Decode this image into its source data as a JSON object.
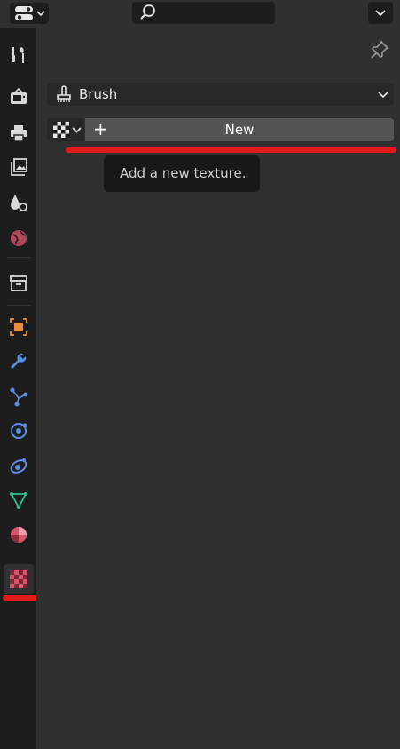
{
  "search": {
    "placeholder": ""
  },
  "context": {
    "label": "Brush"
  },
  "texture": {
    "new_label": "New",
    "new_symbol": "+"
  },
  "tooltip": {
    "text": "Add a new texture."
  },
  "sidebar": {
    "tabs": [
      {
        "name": "tool-tab",
        "icon": "tool-icon"
      },
      {
        "name": "render-tab",
        "icon": "render-icon"
      },
      {
        "name": "output-tab",
        "icon": "output-icon"
      },
      {
        "name": "view-layer-tab",
        "icon": "view-layer-icon"
      },
      {
        "name": "scene-tab",
        "icon": "scene-icon"
      },
      {
        "name": "world-tab",
        "icon": "world-icon"
      },
      {
        "name": "collection-tab",
        "icon": "collection-icon"
      },
      {
        "name": "object-tab",
        "icon": "object-icon"
      },
      {
        "name": "modifiers-tab",
        "icon": "wrench-icon"
      },
      {
        "name": "particles-tab",
        "icon": "particles-icon"
      },
      {
        "name": "physics-tab",
        "icon": "physics-icon"
      },
      {
        "name": "constraints-tab",
        "icon": "constraints-icon"
      },
      {
        "name": "data-tab",
        "icon": "mesh-data-icon"
      },
      {
        "name": "material-tab",
        "icon": "material-icon"
      },
      {
        "name": "texture-tab",
        "icon": "texture-checker-icon",
        "active": true
      }
    ]
  },
  "colors": {
    "highlight": "#e11b1b",
    "panel": "#303030",
    "sidebar": "#1d1d1d",
    "button": "#545454"
  }
}
